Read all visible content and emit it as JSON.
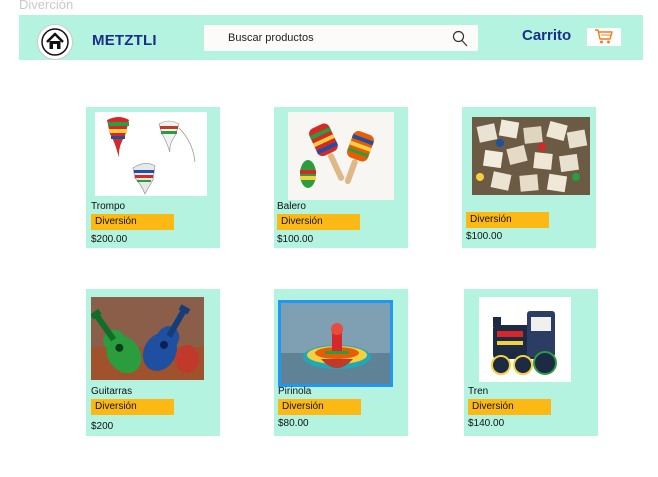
{
  "page": {
    "label": "Diverción"
  },
  "header": {
    "brand": "METZTLI",
    "search_placeholder": "Buscar productos",
    "cart_label": "Carrito",
    "icons": {
      "home": "home-icon",
      "search": "search-icon",
      "cart": "cart-icon"
    },
    "colors": {
      "bar": "#b3f3e0",
      "brand": "#1b2f8a",
      "cart_icon": "#f47c20"
    }
  },
  "products": [
    {
      "name": "Trompo",
      "category": "Diversión",
      "price": "$200.00"
    },
    {
      "name": "Balero",
      "category": "Diversión",
      "price": "$100.00"
    },
    {
      "name": "",
      "category": "Diversión",
      "price": "$100.00"
    },
    {
      "name": "Guitarras",
      "category": "Diversión",
      "price": "$200"
    },
    {
      "name": "Pirinola",
      "category": "Diversión",
      "price": "$80.00"
    },
    {
      "name": "Tren",
      "category": "Diversión",
      "price": "$140.00"
    }
  ],
  "colors": {
    "card_bg": "#b3f3e0",
    "tag_bg": "#fdb913",
    "selected_border": "#2196f3"
  }
}
